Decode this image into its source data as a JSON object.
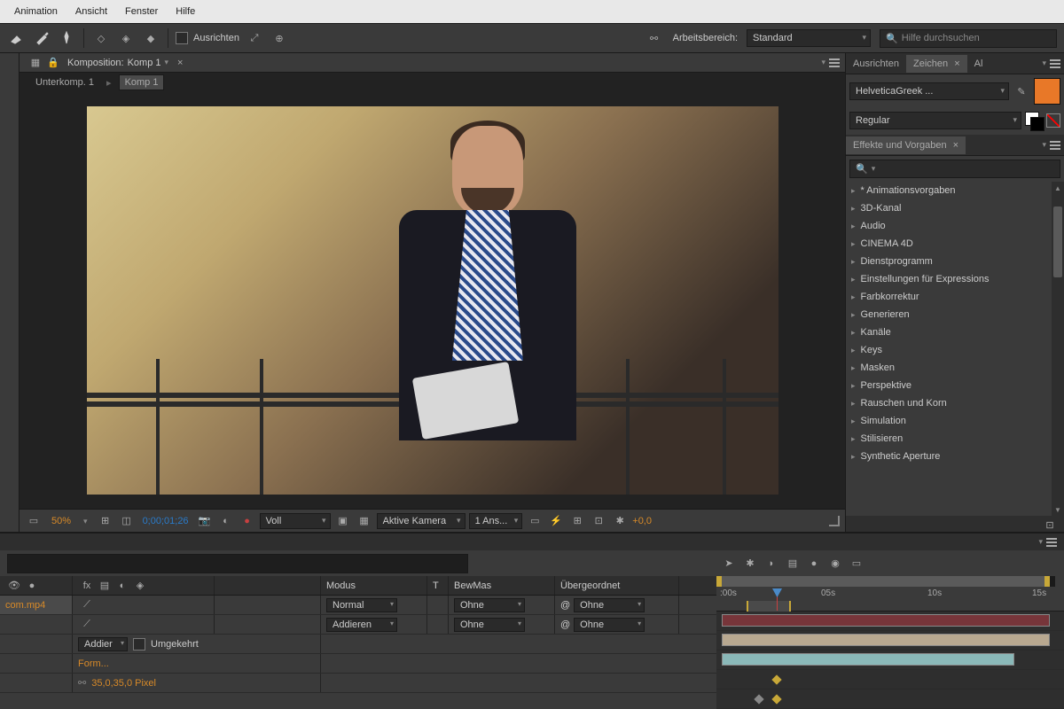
{
  "menu": [
    "Animation",
    "Ansicht",
    "Fenster",
    "Hilfe"
  ],
  "toolbar": {
    "align_label": "Ausrichten",
    "workspace_label": "Arbeitsbereich:",
    "workspace_value": "Standard",
    "search_placeholder": "Hilfe durchsuchen"
  },
  "comp": {
    "title_prefix": "Komposition:",
    "title_name": "Komp 1",
    "crumb1": "Unterkomp. 1",
    "crumb2": "Komp 1",
    "zoom": "50%",
    "timecode": "0;00;01;26",
    "resolution": "Voll",
    "camera": "Aktive Kamera",
    "views": "1 Ans...",
    "exposure": "+0,0"
  },
  "side": {
    "tab_align": "Ausrichten",
    "tab_char": "Zeichen",
    "tab_al": "Al",
    "font": "HelveticaGreek ...",
    "weight": "Regular",
    "swatch_color": "#e87828",
    "effects_title": "Effekte und Vorgaben",
    "effects": [
      "* Animationsvorgaben",
      "3D-Kanal",
      "Audio",
      "CINEMA 4D",
      "Dienstprogramm",
      "Einstellungen für Expressions",
      "Farbkorrektur",
      "Generieren",
      "Kanäle",
      "Keys",
      "Masken",
      "Perspektive",
      "Rauschen und Korn",
      "Simulation",
      "Stilisieren",
      "Synthetic Aperture"
    ]
  },
  "timeline": {
    "col_modus": "Modus",
    "col_t": "T",
    "col_bewmas": "BewMas",
    "col_parent": "Übergeordnet",
    "ticks": [
      ":00s",
      "05s",
      "10s",
      "15s"
    ],
    "layer1": {
      "name": "com.mp4",
      "mode": "Normal",
      "bew": "Ohne",
      "parent": "Ohne"
    },
    "layer2": {
      "mode": "Addieren",
      "bew": "Ohne",
      "parent": "Ohne"
    },
    "sub_mode": "Addier",
    "sub_inverted": "Umgekehrt",
    "prop_form": "Form...",
    "prop_pixel": "35,0,35,0 Pixel"
  }
}
